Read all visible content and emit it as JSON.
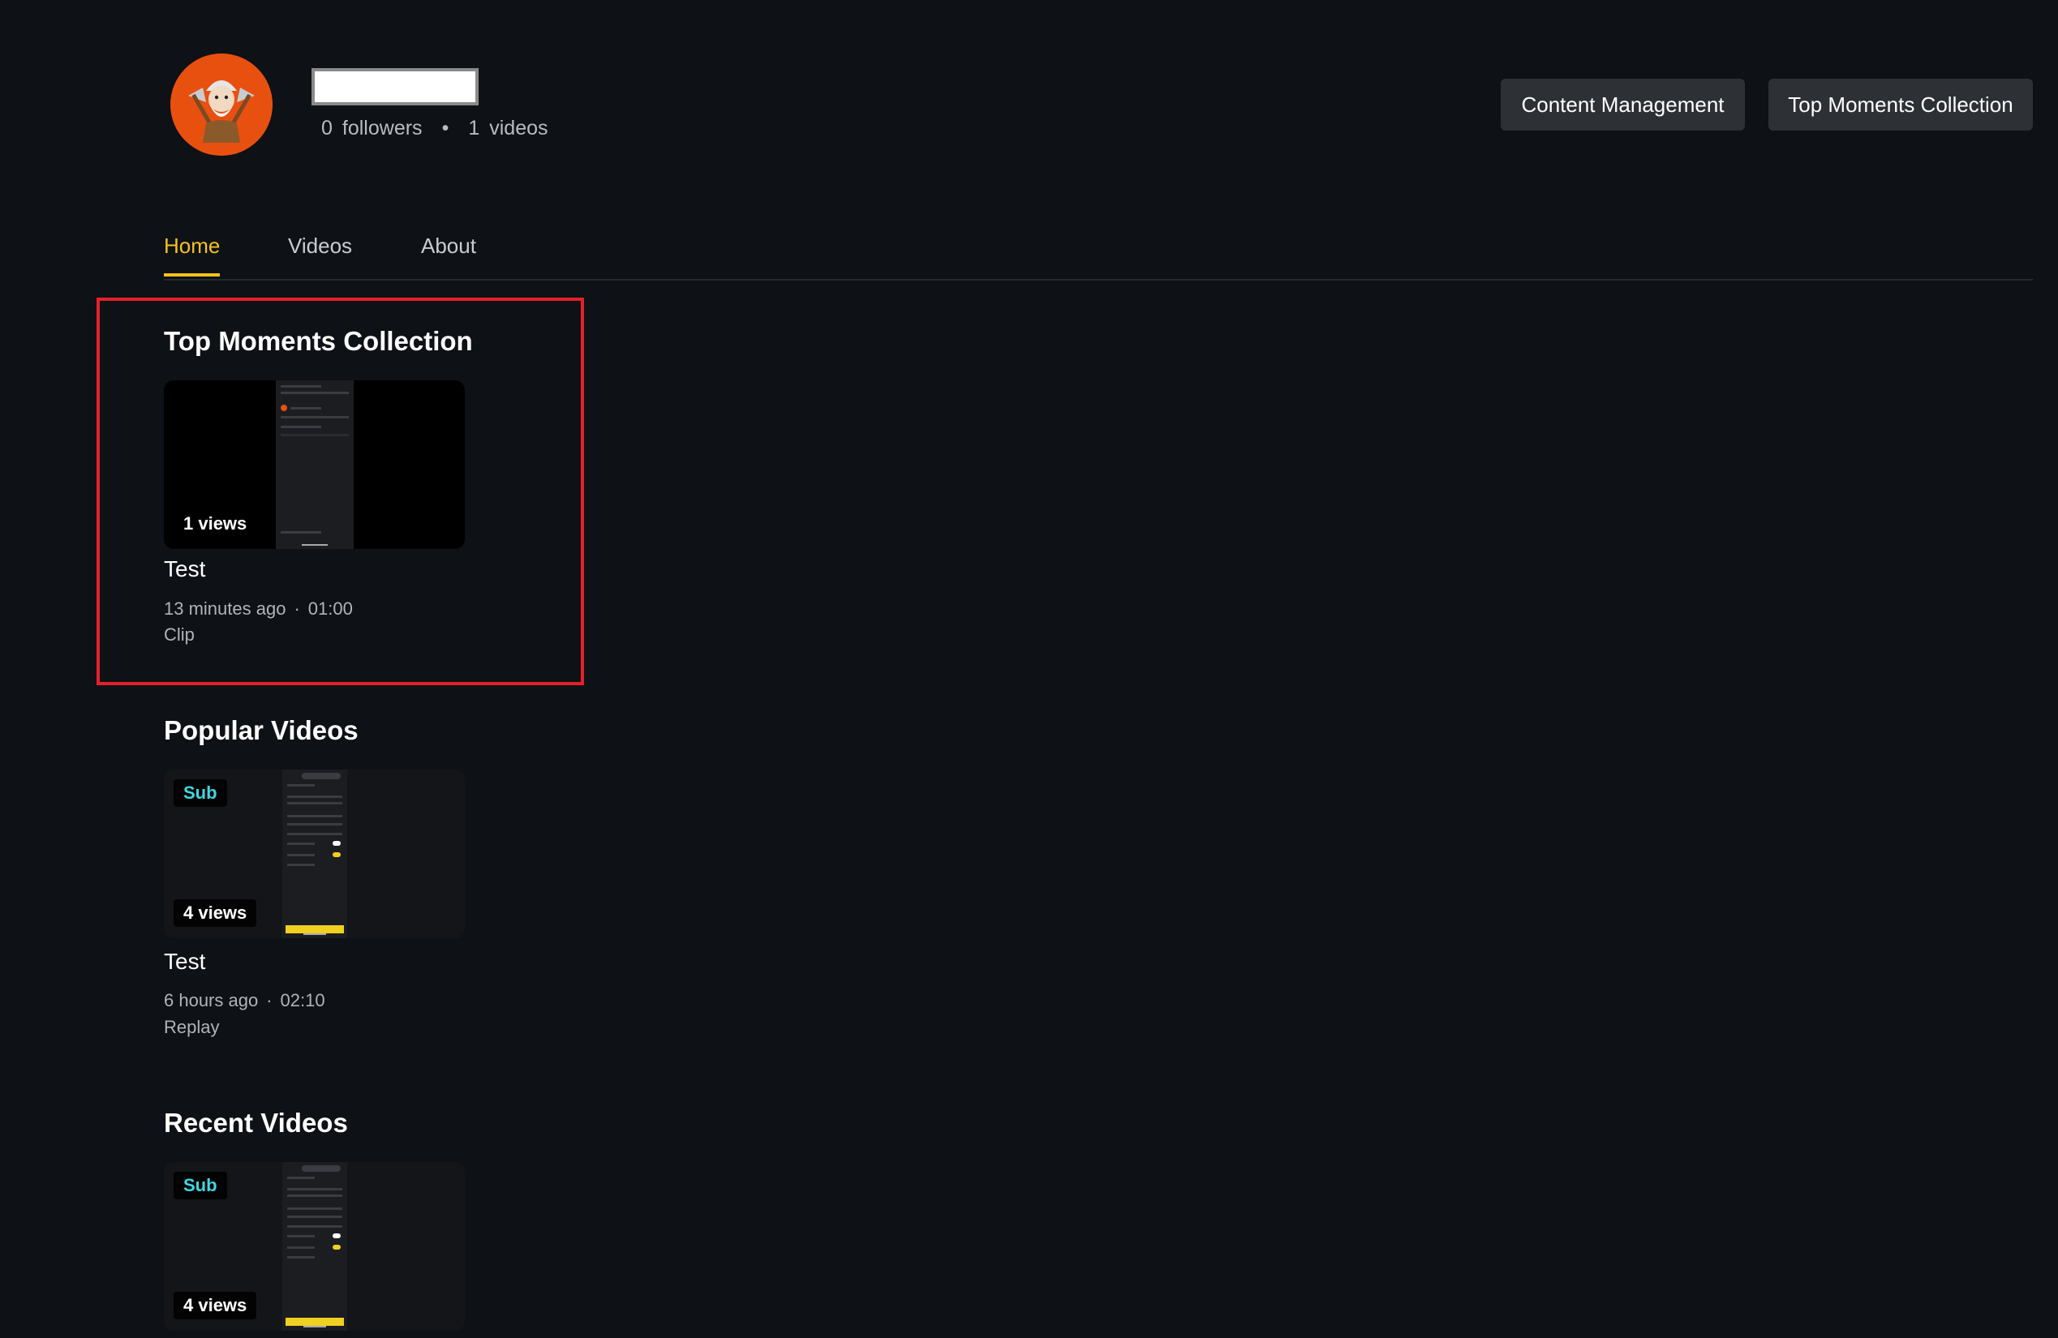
{
  "channel": {
    "followers_count": "0",
    "followers_label": "followers",
    "videos_count": "1",
    "videos_label": "videos",
    "separator": "•"
  },
  "header_buttons": {
    "content_management": "Content Management",
    "top_moments_collection": "Top Moments Collection"
  },
  "tabs": [
    {
      "label": "Home",
      "active": true
    },
    {
      "label": "Videos",
      "active": false
    },
    {
      "label": "About",
      "active": false
    }
  ],
  "sections": {
    "top_moments": {
      "title": "Top Moments Collection",
      "video": {
        "views": "1 views",
        "title": "Test",
        "age": "13 minutes ago",
        "meta_separator": "·",
        "duration": "01:00",
        "type": "Clip"
      }
    },
    "popular": {
      "title": "Popular Videos",
      "video": {
        "badge": "Sub",
        "views": "4 views",
        "title": "Test",
        "age": "6 hours ago",
        "meta_separator": "·",
        "duration": "02:10",
        "type": "Replay"
      }
    },
    "recent": {
      "title": "Recent Videos",
      "video": {
        "badge": "Sub",
        "views": "4 views"
      }
    }
  },
  "colors": {
    "background": "#0e1115",
    "accent": "#f5c21b",
    "highlight_border": "#e5202a",
    "sub_badge": "#40d6e0",
    "avatar": "#e8500f"
  },
  "icons": {
    "avatar": "viking-warrior-avatar-icon"
  }
}
